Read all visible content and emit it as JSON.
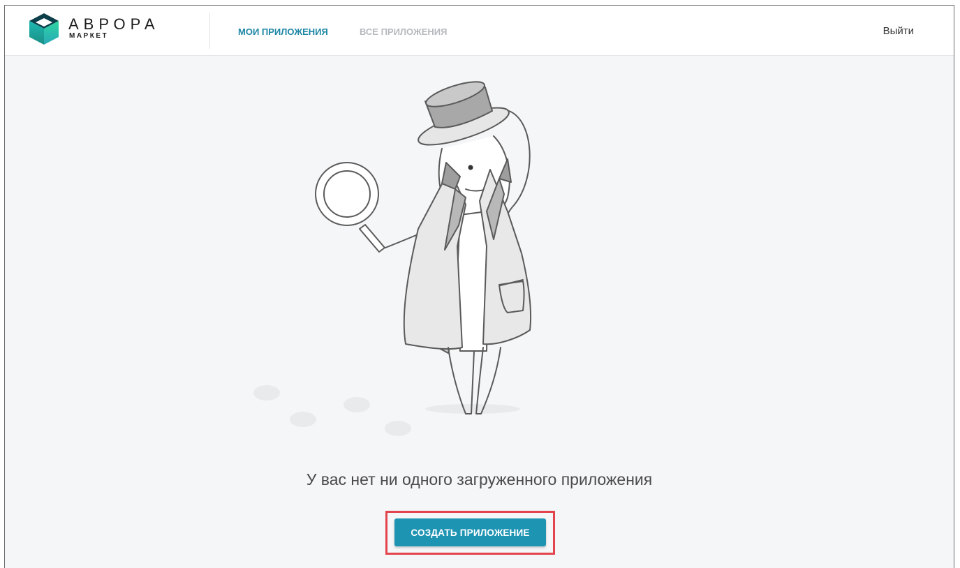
{
  "header": {
    "brand_title": "АВРОРА",
    "brand_subtitle": "МАРКЕТ",
    "logo_icon": "cube-logo-icon",
    "accent_color": "#1e86a4",
    "nav_tabs": [
      {
        "label": "МОИ ПРИЛОЖЕНИЯ",
        "active": true
      },
      {
        "label": "ВСЕ ПРИЛОЖЕНИЯ",
        "active": false
      }
    ],
    "logout_label": "Выйти"
  },
  "main": {
    "illustration": "detective-illustration",
    "empty_message": "У вас нет ни одного загруженного приложения",
    "create_button_label": "СОЗДАТЬ ПРИЛОЖЕНИЕ",
    "button_color": "#1e94b3",
    "highlight_color": "#e2454d"
  }
}
